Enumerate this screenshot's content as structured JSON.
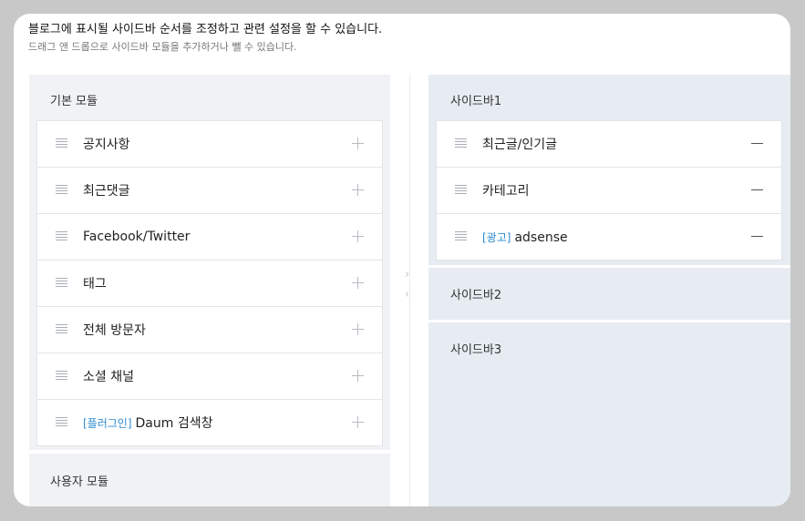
{
  "header": {
    "title": "블로그에 표시될 사이드바 순서를 조정하고 관련 설정을 할 수 있습니다.",
    "subtitle": "드래그 앤 드롭으로 사이드바 모듈을 추가하거나 뺄 수 있습니다."
  },
  "left": {
    "basic_title": "기본 모듈",
    "user_title": "사용자 모듈",
    "items": [
      {
        "label": "공지사항",
        "tag": ""
      },
      {
        "label": "최근댓글",
        "tag": ""
      },
      {
        "label": "Facebook/Twitter",
        "tag": ""
      },
      {
        "label": "태그",
        "tag": ""
      },
      {
        "label": "전체 방문자",
        "tag": ""
      },
      {
        "label": "소셜 채널",
        "tag": ""
      },
      {
        "label": "Daum 검색창",
        "tag": "[플러그인]"
      }
    ]
  },
  "right": {
    "sidebar1_title": "사이드바1",
    "sidebar2_title": "사이드바2",
    "sidebar3_title": "사이드바3",
    "items": [
      {
        "label": "최근글/인기글",
        "tag": ""
      },
      {
        "label": "카테고리",
        "tag": ""
      },
      {
        "label": "adsense",
        "tag": "[광고]"
      }
    ]
  },
  "icons": {
    "handle": "drag-handle-icon",
    "add": "plus-icon",
    "remove": "minus-icon",
    "move_right": "chevron-right-icon",
    "move_left": "chevron-left-icon"
  },
  "colors": {
    "tag": "#2a8bd2",
    "left_panel_bg": "#f0f2f5",
    "right_panel_bg": "#e6ecf2"
  }
}
